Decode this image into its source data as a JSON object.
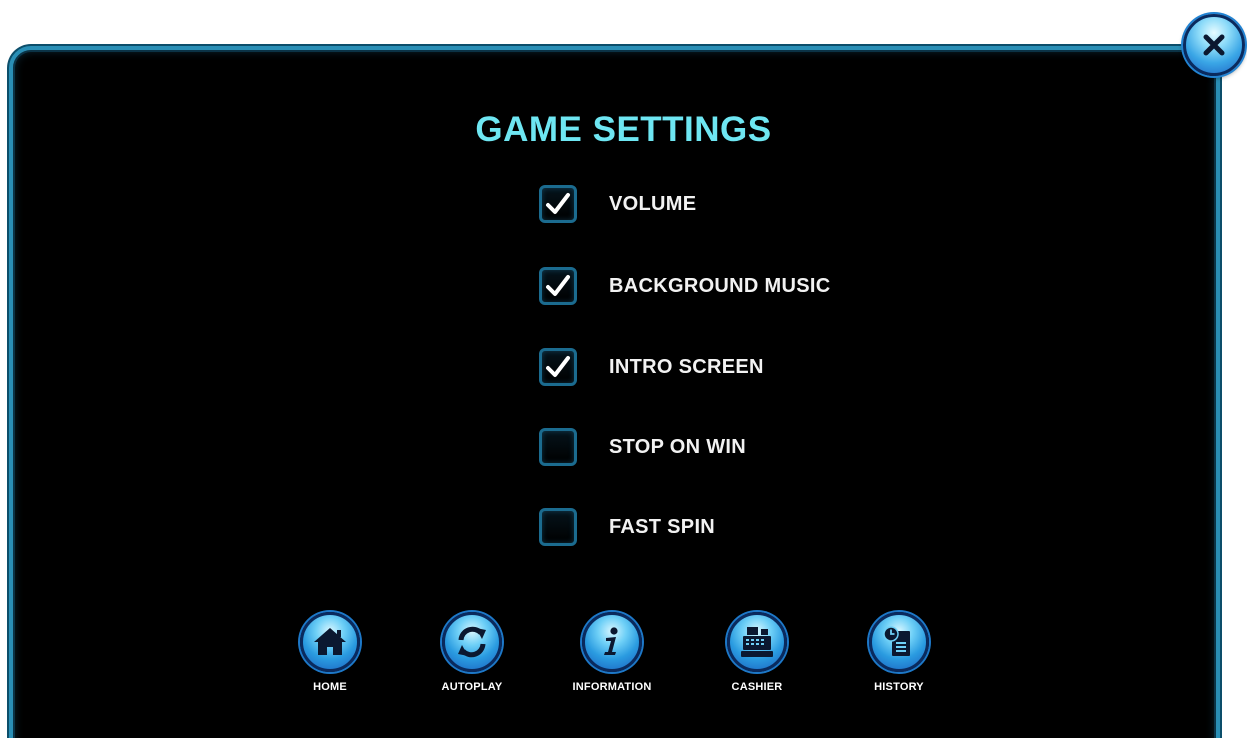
{
  "title": "GAME SETTINGS",
  "colors": {
    "title": "#6ee6f2",
    "panel_border": "#2a8fb6",
    "checkbox_border": "#1b6b8f",
    "button_blue": "#2a9be0"
  },
  "options": [
    {
      "label": "VOLUME",
      "checked": true
    },
    {
      "label": "BACKGROUND MUSIC",
      "checked": true
    },
    {
      "label": "INTRO SCREEN",
      "checked": true
    },
    {
      "label": "STOP ON WIN",
      "checked": false
    },
    {
      "label": "FAST SPIN",
      "checked": false
    }
  ],
  "nav": [
    {
      "label": "HOME",
      "icon": "home-icon"
    },
    {
      "label": "AUTOPLAY",
      "icon": "autoplay-icon"
    },
    {
      "label": "INFORMATION",
      "icon": "information-icon"
    },
    {
      "label": "CASHIER",
      "icon": "cash-register-icon"
    },
    {
      "label": "HISTORY",
      "icon": "history-icon"
    }
  ],
  "close": {
    "icon": "close-icon"
  }
}
